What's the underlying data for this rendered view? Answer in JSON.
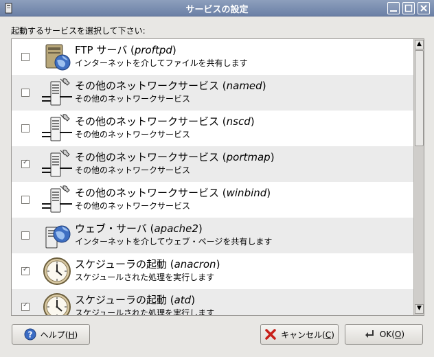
{
  "window": {
    "title": "サービスの設定"
  },
  "prompt": "起動するサービスを選択して下さい:",
  "services": [
    {
      "title": "FTP サーバ (",
      "name": "proftpd",
      "close": ")",
      "desc": "インターネットを介してファイルを共有します",
      "checked": false,
      "icon": "ftp-server-icon"
    },
    {
      "title": "その他のネットワークサービス (",
      "name": "named",
      "close": ")",
      "desc": "その他のネットワークサービス",
      "checked": false,
      "icon": "network-server-icon"
    },
    {
      "title": "その他のネットワークサービス (",
      "name": "nscd",
      "close": ")",
      "desc": "その他のネットワークサービス",
      "checked": false,
      "icon": "network-server-icon"
    },
    {
      "title": "その他のネットワークサービス (",
      "name": "portmap",
      "close": ")",
      "desc": "その他のネットワークサービス",
      "checked": true,
      "icon": "network-server-icon"
    },
    {
      "title": "その他のネットワークサービス (",
      "name": "winbind",
      "close": ")",
      "desc": "その他のネットワークサービス",
      "checked": false,
      "icon": "network-server-icon"
    },
    {
      "title": "ウェブ・サーバ (",
      "name": "apache2",
      "close": ")",
      "desc": "インターネットを介してウェブ・ページを共有します",
      "checked": false,
      "icon": "web-server-icon"
    },
    {
      "title": "スケジューラの起動 (",
      "name": "anacron",
      "close": ")",
      "desc": "スケジュールされた処理を実行します",
      "checked": true,
      "icon": "clock-icon"
    },
    {
      "title": "スケジューラの起動 (",
      "name": "atd",
      "close": ")",
      "desc": "スケジュールされた処理を実行します",
      "checked": true,
      "icon": "clock-icon"
    }
  ],
  "buttons": {
    "help_label": "ヘルプ(",
    "help_key": "H",
    "help_close": ")",
    "cancel_label": "キャンセル(",
    "cancel_key": "C",
    "cancel_close": ")",
    "ok_label": "OK(",
    "ok_key": "O",
    "ok_close": ")"
  }
}
